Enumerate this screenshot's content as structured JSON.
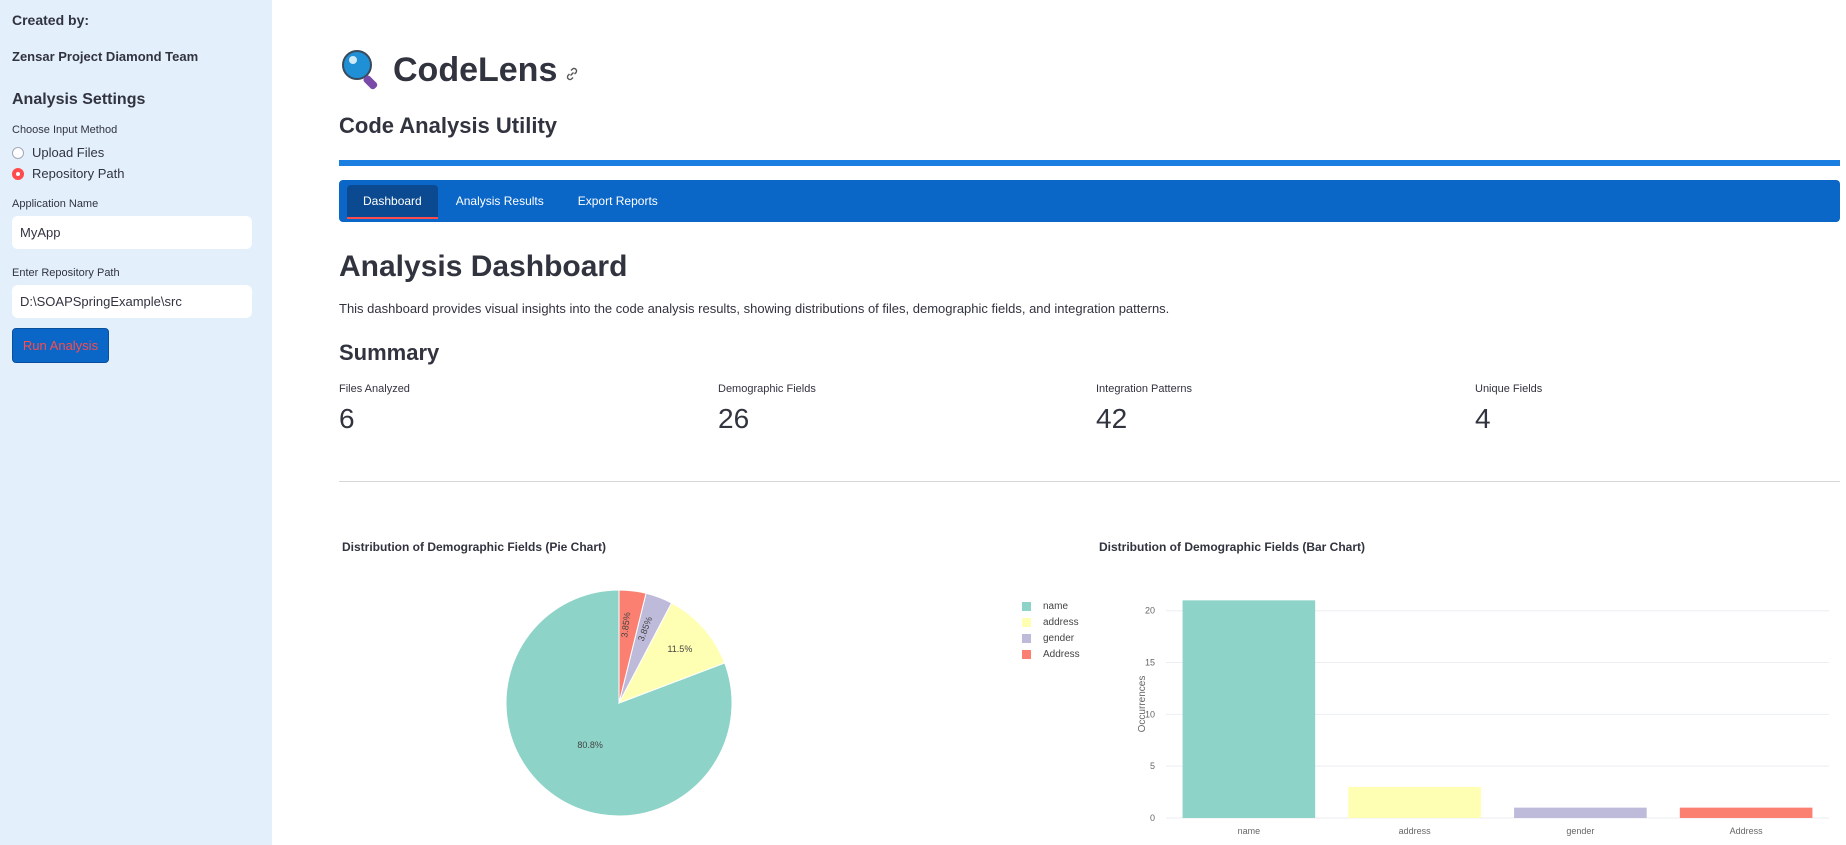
{
  "sidebar": {
    "created_by_label": "Created by:",
    "team": "Zensar Project Diamond Team",
    "settings_heading": "Analysis Settings",
    "input_method_label": "Choose Input Method",
    "input_methods": [
      {
        "label": "Upload Files",
        "selected": false
      },
      {
        "label": "Repository Path",
        "selected": true
      }
    ],
    "app_name_label": "Application Name",
    "app_name_value": "MyApp",
    "repo_path_label": "Enter Repository Path",
    "repo_path_value": "D:\\SOAPSpringExample\\src",
    "run_button": "Run Analysis"
  },
  "header": {
    "title": "CodeLens",
    "subtitle": "Code Analysis Utility"
  },
  "tabs": [
    {
      "label": "Dashboard",
      "active": true
    },
    {
      "label": "Analysis Results",
      "active": false
    },
    {
      "label": "Export Reports",
      "active": false
    }
  ],
  "dashboard": {
    "heading": "Analysis Dashboard",
    "description": "This dashboard provides visual insights into the code analysis results, showing distributions of files, demographic fields, and integration patterns.",
    "summary_heading": "Summary",
    "metrics": [
      {
        "label": "Files Analyzed",
        "value": "6"
      },
      {
        "label": "Demographic Fields",
        "value": "26"
      },
      {
        "label": "Integration Patterns",
        "value": "42"
      },
      {
        "label": "Unique Fields",
        "value": "4"
      }
    ],
    "pie_title": "Distribution of Demographic Fields (Pie Chart)",
    "bar_title": "Distribution of Demographic Fields (Bar Chart)"
  },
  "colors": {
    "name": "#8dd3c7",
    "address": "#ffffb3",
    "gender": "#bebada",
    "Address": "#fb8072",
    "accent": "#0a66c7",
    "sidebar_bg": "#e3f0fc"
  },
  "chart_data": [
    {
      "type": "pie",
      "title": "Distribution of Demographic Fields (Pie Chart)",
      "labels": [
        "name",
        "address",
        "gender",
        "Address"
      ],
      "values": [
        21,
        3,
        1,
        1
      ],
      "percent_labels": [
        "80.8%",
        "11.5%",
        "3.85%",
        "3.85%"
      ],
      "legend": [
        "name",
        "address",
        "gender",
        "Address"
      ],
      "legend_position": "right"
    },
    {
      "type": "bar",
      "title": "Distribution of Demographic Fields (Bar Chart)",
      "categories": [
        "name",
        "address",
        "gender",
        "Address"
      ],
      "values": [
        21,
        3,
        1,
        1
      ],
      "xlabel": "",
      "ylabel": "Occurrences",
      "ylim": [
        0,
        22
      ],
      "yticks": [
        "0",
        "5",
        "10",
        "15",
        "20"
      ],
      "grid": true
    }
  ]
}
